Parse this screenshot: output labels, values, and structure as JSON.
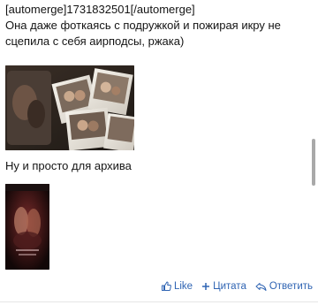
{
  "post": {
    "lines": [
      "[automerge]1731832501[/automerge]",
      "Она даже фоткаясь с подружкой и пожирая икру не",
      "сцепила с себя аирподсы, ржака)",
      "Ну и просто для архива"
    ]
  },
  "actions": {
    "like": "Like",
    "quote": "Цитата",
    "reply": "Ответить"
  },
  "icons": {
    "like": "thumbs-up-icon",
    "quote": "plus-icon",
    "reply": "reply-icon"
  },
  "colors": {
    "link": "#2f64b3"
  }
}
